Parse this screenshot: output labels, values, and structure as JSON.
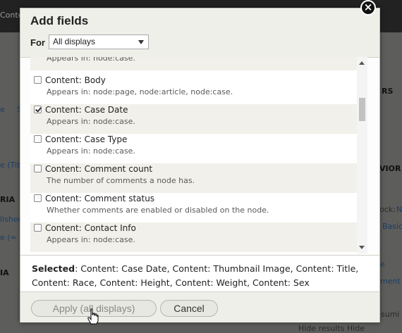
{
  "background": {
    "top_text": "Conten",
    "texts": [
      {
        "id": "bg-e",
        "text": "e"
      },
      {
        "id": "bg-s",
        "text": "S"
      },
      {
        "id": "bg-titl",
        "text": "e (Titl"
      },
      {
        "id": "bg-ria",
        "text": "RIA"
      },
      {
        "id": "bg-lished",
        "text": "lished"
      },
      {
        "id": "bg-ee",
        "text": "e (="
      },
      {
        "id": "bg-ia",
        "text": "IA"
      },
      {
        "id": "bg-ers",
        "text": "RS"
      },
      {
        "id": "bg-vior",
        "text": "VIOR"
      },
      {
        "id": "bg-ock",
        "text": "ock:"
      },
      {
        "id": "bg-n",
        "text": "N"
      },
      {
        "id": "bg-basic",
        "text": "Basic"
      },
      {
        "id": "bg-e2",
        "text": "e"
      },
      {
        "id": "bg-ment",
        "text": "ment"
      },
      {
        "id": "bg-sumi",
        "text": "sumi"
      },
      {
        "id": "bg-bottom",
        "text": "Hide results  Hide"
      }
    ]
  },
  "modal": {
    "title": "Add fields",
    "for_label": "For",
    "display_select": "All displays",
    "close_label": "×",
    "items": [
      {
        "name": "",
        "desc": "Appears in: node:case.",
        "checked": false,
        "shaded": true,
        "partial": true
      },
      {
        "name": "Content: Body",
        "desc": "Appears in: node:page, node:article, node:case.",
        "checked": false,
        "shaded": false
      },
      {
        "name": "Content: Case Date",
        "desc": "Appears in: node:case.",
        "checked": true,
        "shaded": true
      },
      {
        "name": "Content: Case Type",
        "desc": "Appears in: node:case.",
        "checked": false,
        "shaded": false
      },
      {
        "name": "Content: Comment count",
        "desc": "The number of comments a node has.",
        "checked": false,
        "shaded": true
      },
      {
        "name": "Content: Comment status",
        "desc": "Whether comments are enabled or disabled on the node.",
        "checked": false,
        "shaded": false
      },
      {
        "name": "Content: Contact Info",
        "desc": "Appears in: node:case.",
        "checked": false,
        "shaded": true
      },
      {
        "name": "",
        "desc": "",
        "checked": false,
        "shaded": false,
        "partial": true
      }
    ],
    "selected_label": "Selected",
    "selected_text": ": Content: Case Date, Content: Thumbnail Image, Content: Title, Content: Race, Content: Height, Content: Weight, Content: Sex",
    "apply_label": "Apply (all displays)",
    "cancel_label": "Cancel"
  },
  "colors": {
    "header_bg": "#efefe9",
    "shaded_row": "#f1f0ea",
    "overlay": "#5d5d5b"
  }
}
